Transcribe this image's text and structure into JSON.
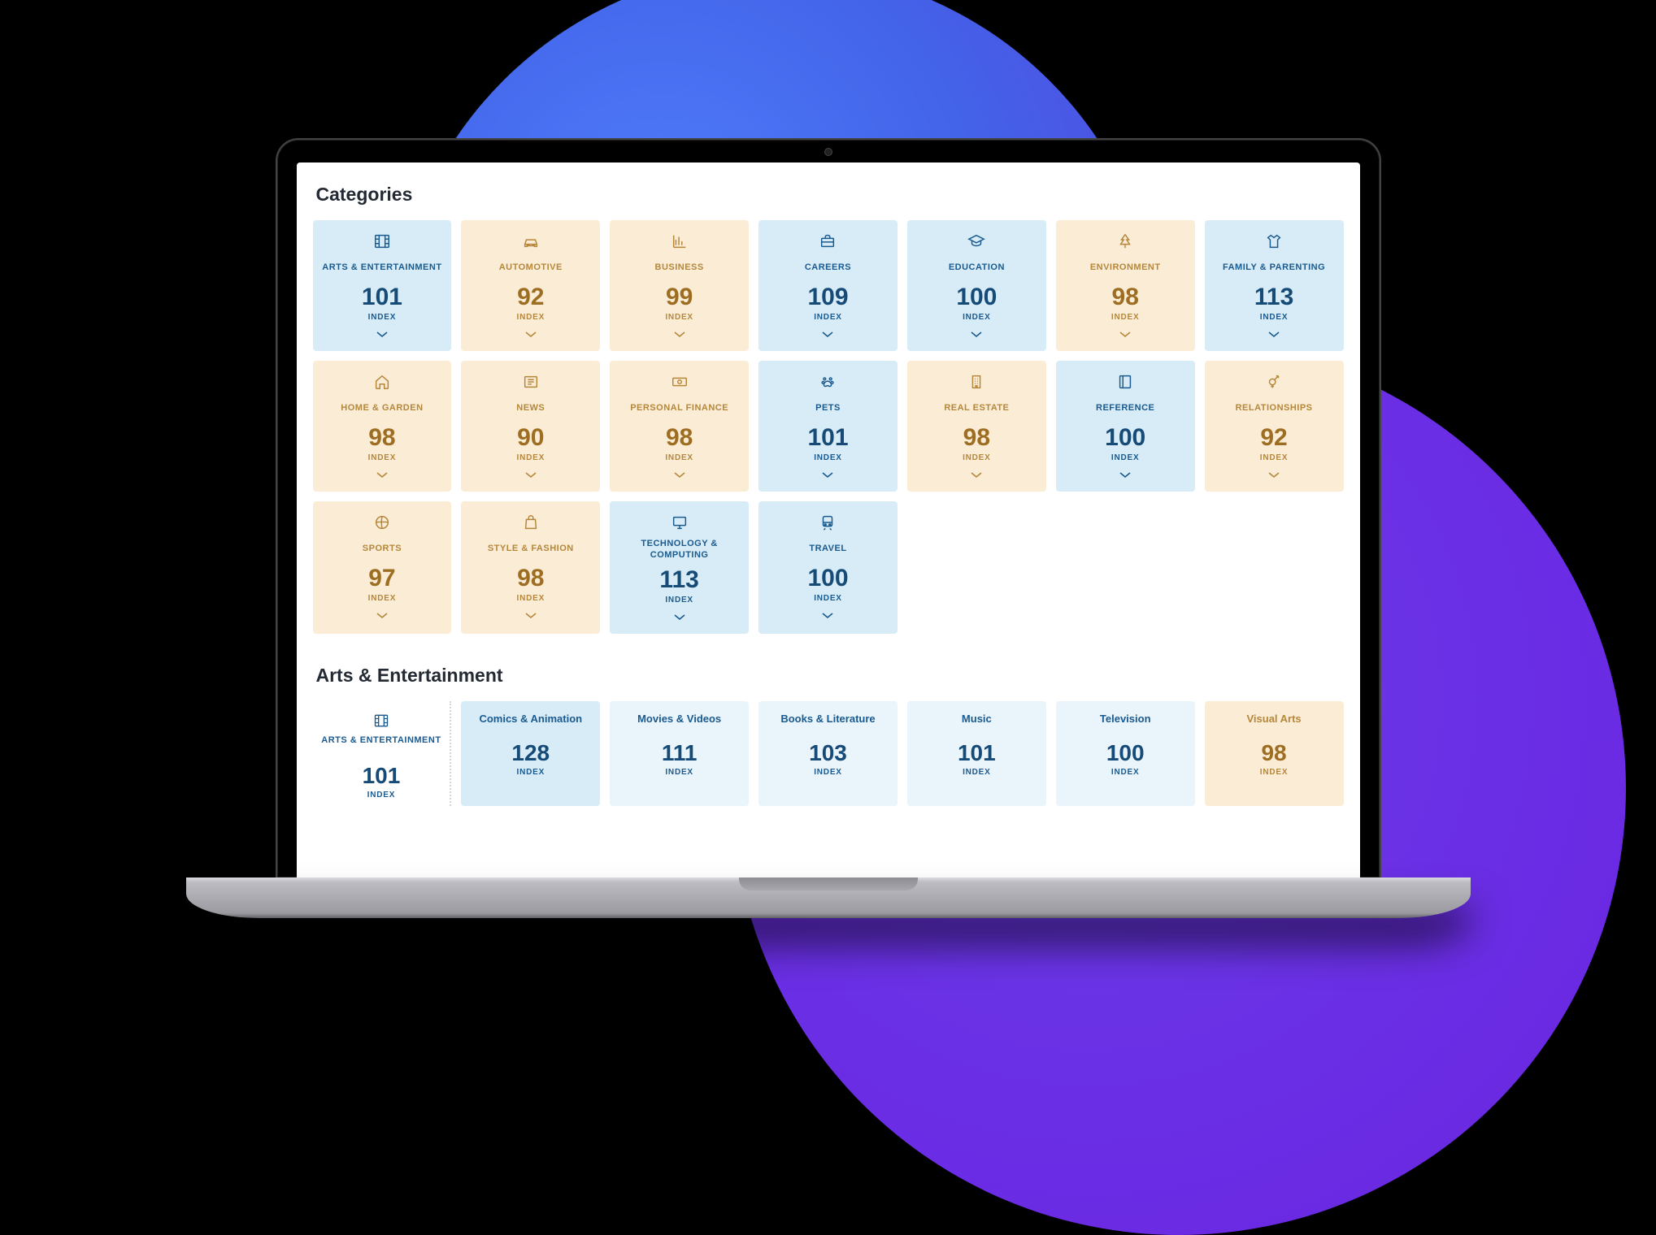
{
  "sections": {
    "categories_title": "Categories",
    "sub_title": "Arts & Entertainment"
  },
  "labels": {
    "index": "INDEX"
  },
  "categories": [
    {
      "label": "ARTS & ENTERTAINMENT",
      "value": "101",
      "tone": "blue",
      "icon": "film"
    },
    {
      "label": "AUTOMOTIVE",
      "value": "92",
      "tone": "beige",
      "icon": "car"
    },
    {
      "label": "BUSINESS",
      "value": "99",
      "tone": "beige",
      "icon": "chart"
    },
    {
      "label": "CAREERS",
      "value": "109",
      "tone": "blue",
      "icon": "briefcase"
    },
    {
      "label": "EDUCATION",
      "value": "100",
      "tone": "blue",
      "icon": "grad"
    },
    {
      "label": "ENVIRONMENT",
      "value": "98",
      "tone": "beige",
      "icon": "tree"
    },
    {
      "label": "FAMILY & PARENTING",
      "value": "113",
      "tone": "blue",
      "icon": "shirt"
    },
    {
      "label": "HOME & GARDEN",
      "value": "98",
      "tone": "beige",
      "icon": "home"
    },
    {
      "label": "NEWS",
      "value": "90",
      "tone": "beige",
      "icon": "news"
    },
    {
      "label": "PERSONAL FINANCE",
      "value": "98",
      "tone": "beige",
      "icon": "money"
    },
    {
      "label": "PETS",
      "value": "101",
      "tone": "blue",
      "icon": "paw"
    },
    {
      "label": "REAL ESTATE",
      "value": "98",
      "tone": "beige",
      "icon": "building"
    },
    {
      "label": "REFERENCE",
      "value": "100",
      "tone": "blue",
      "icon": "book"
    },
    {
      "label": "RELATIONSHIPS",
      "value": "92",
      "tone": "beige",
      "icon": "gender"
    },
    {
      "label": "SPORTS",
      "value": "97",
      "tone": "beige",
      "icon": "ball"
    },
    {
      "label": "STYLE & FASHION",
      "value": "98",
      "tone": "beige",
      "icon": "bag"
    },
    {
      "label": "TECHNOLOGY & COMPUTING",
      "value": "113",
      "tone": "blue",
      "icon": "monitor"
    },
    {
      "label": "TRAVEL",
      "value": "100",
      "tone": "blue",
      "icon": "train"
    }
  ],
  "subcategories": [
    {
      "label": "ARTS & ENTERTAINMENT",
      "value": "101",
      "tone": "lead",
      "icon": "film"
    },
    {
      "label": "Comics & Animation",
      "value": "128",
      "tone": "blue"
    },
    {
      "label": "Movies & Videos",
      "value": "111",
      "tone": "lightblue"
    },
    {
      "label": "Books & Literature",
      "value": "103",
      "tone": "lightblue"
    },
    {
      "label": "Music",
      "value": "101",
      "tone": "lightblue"
    },
    {
      "label": "Television",
      "value": "100",
      "tone": "lightblue"
    },
    {
      "label": "Visual Arts",
      "value": "98",
      "tone": "beige"
    }
  ]
}
